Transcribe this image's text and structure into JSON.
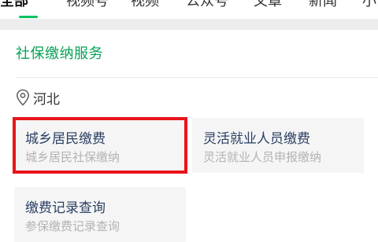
{
  "tabs": [
    {
      "label": "全部",
      "active": true
    },
    {
      "label": "视频号",
      "active": false
    },
    {
      "label": "视频",
      "active": false
    },
    {
      "label": "公众号",
      "active": false
    },
    {
      "label": "文章",
      "active": false
    },
    {
      "label": "新闻",
      "active": false
    },
    {
      "label": "小",
      "active": false
    }
  ],
  "section": {
    "title": "社保缴纳服务"
  },
  "location": {
    "icon": "location-pin-icon",
    "text": "河北"
  },
  "services": [
    {
      "title": "城乡居民缴费",
      "subtitle": "城乡居民社保缴纳",
      "highlighted": true
    },
    {
      "title": "灵活就业人员缴费",
      "subtitle": "灵活就业人员申报缴纳",
      "highlighted": false
    },
    {
      "title": "缴费记录查询",
      "subtitle": "参保缴费记录查询",
      "highlighted": false
    }
  ],
  "colors": {
    "accent": "#07a356",
    "highlight": "#e8141b",
    "card_bg": "#f5f5f5",
    "title_text": "#2b3f63",
    "sub_text": "#b3b3b3"
  }
}
